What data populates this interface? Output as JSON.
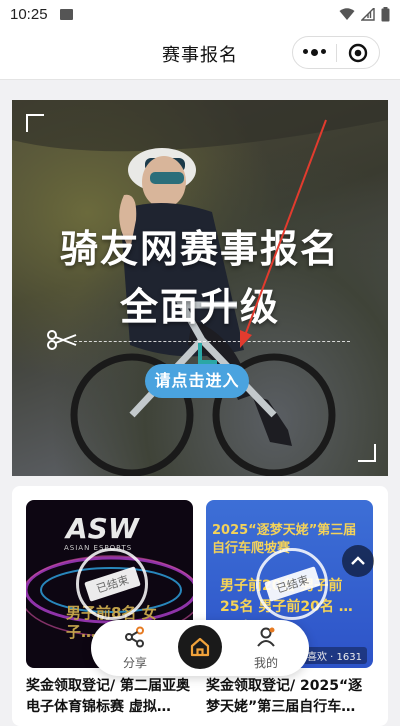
{
  "status_bar": {
    "time": "10:25"
  },
  "navbar": {
    "title": "赛事报名"
  },
  "banner": {
    "headline_line1": "骑友网赛事报名",
    "headline_line2": "全面升级",
    "enter_button": "请点击进入",
    "accent_color": "#4aa3df"
  },
  "events": [
    {
      "title": "奖金领取登记/ 第二届亚奥电子体育锦标赛 虚拟…",
      "status": "已结束",
      "cover_text_top": "ASIAN ESPORTS",
      "cover_text_bottom": "男子前8名 女子…"
    },
    {
      "title": "奖金领取登记/ 2025“逐梦天姥”第三届自行车…",
      "status": "已结束",
      "cover_text_top": "2025“逐梦天姥”第三届自行车爬坡赛",
      "cover_text_bottom": "男子前20名 男子前25名 男子前20名 …51名",
      "views": "喜欢 · 1631"
    }
  ],
  "tabbar": {
    "share_label": "分享",
    "mine_label": "我的"
  }
}
